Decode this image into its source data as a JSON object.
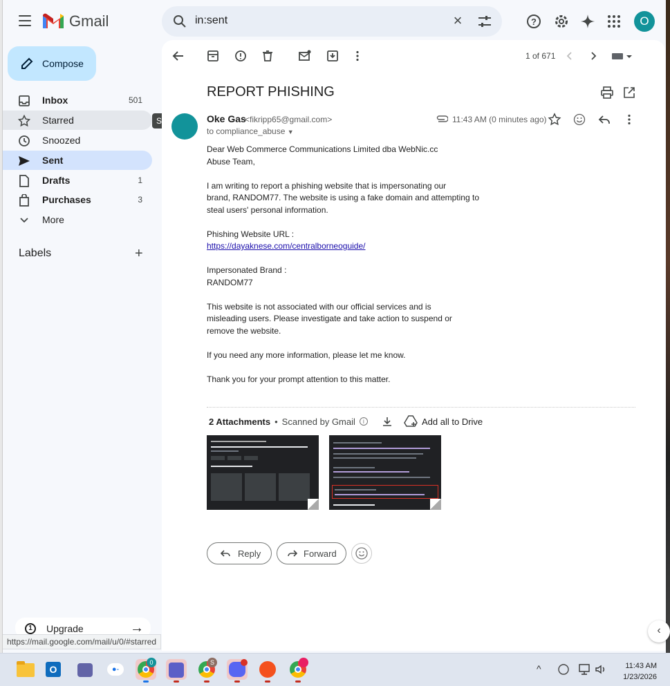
{
  "app": {
    "name": "Gmail"
  },
  "search": {
    "value": "in:sent"
  },
  "header": {
    "avatar_initial": "O"
  },
  "sidebar": {
    "compose_label": "Compose",
    "items": [
      {
        "label": "Inbox",
        "count": "501"
      },
      {
        "label": "Starred",
        "count": ""
      },
      {
        "label": "Snoozed",
        "count": ""
      },
      {
        "label": "Sent",
        "count": ""
      },
      {
        "label": "Drafts",
        "count": "1"
      },
      {
        "label": "Purchases",
        "count": "3"
      },
      {
        "label": "More",
        "count": ""
      }
    ],
    "tooltip": "Starred",
    "labels_title": "Labels",
    "upgrade_label": "Upgrade"
  },
  "status_url": "https://mail.google.com/mail/u/0/#starred",
  "toolbar": {
    "pager": "1 of 671"
  },
  "email": {
    "subject": "REPORT PHISHING",
    "sender_name": "Oke Gas",
    "sender_email": "<fikripp65@gmail.com>",
    "to": "to compliance_abuse",
    "time": "11:43 AM (0 minutes ago)",
    "body": [
      "Dear Web Commerce Communications Limited dba WebNic.cc",
      "Abuse Team,",
      "I am writing to report a phishing website that is impersonating our",
      "brand, RANDOM77. The website is using a fake domain and attempting to",
      "steal users' personal information.",
      "Phishing Website URL :",
      "https://dayaknese.com/centralborneoguide/",
      "Impersonated Brand :",
      "RANDOM77",
      "This website is not associated with our official services and is",
      "misleading users. Please investigate and take action to suspend or",
      "remove the website.",
      "If you need any more information, please let me know.",
      "Thank you for your prompt attention to this matter."
    ],
    "attachments_label": "2 Attachments",
    "scanned_label": "Scanned by Gmail",
    "add_to_drive": "Add all to Drive",
    "reply_label": "Reply",
    "forward_label": "Forward"
  },
  "taskbar": {
    "time": "11:43 AM",
    "date": "1/23/2026"
  },
  "colors": {
    "accent": "#c2e7ff",
    "active_nav": "#d3e3fd",
    "avatar": "#12939a"
  }
}
